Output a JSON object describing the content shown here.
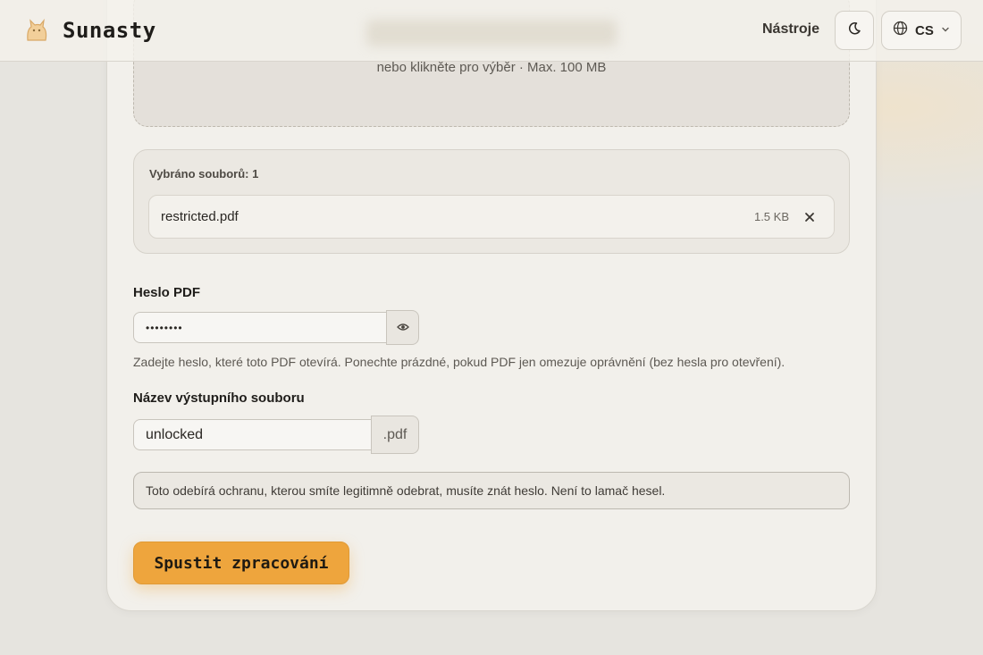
{
  "header": {
    "brand": "Sunasty",
    "nav_tools": "Nástroje",
    "language": "CS",
    "icons": {
      "logo": "cat-logo-icon",
      "theme": "moon-icon",
      "language": "globe-icon",
      "dropdown": "chevron-down-icon"
    }
  },
  "dropzone": {
    "hint": "nebo klikněte pro výběr · Max. 100 MB"
  },
  "files": {
    "title": "Vybráno souborů: 1",
    "items": [
      {
        "name": "restricted.pdf",
        "size": "1.5 KB",
        "remove_icon": "close-icon"
      }
    ]
  },
  "password": {
    "label": "Heslo PDF",
    "value": "••••••••",
    "toggle_icon": "eye-icon",
    "help": "Zadejte heslo, které toto PDF otevírá. Ponechte prázdné, pokud PDF jen omezuje oprávnění (bez hesla pro otevření)."
  },
  "output": {
    "label": "Název výstupního souboru",
    "value": "unlocked",
    "suffix": ".pdf"
  },
  "notice": "Toto odebírá ochranu, kterou smíte legitimně odebrat, musíte znát heslo. Není to lamač hesel.",
  "submit_label": "Spustit zpracování",
  "colors": {
    "accent": "#eea53d",
    "background": "#e6e4df",
    "card": "#f2f0eb"
  }
}
